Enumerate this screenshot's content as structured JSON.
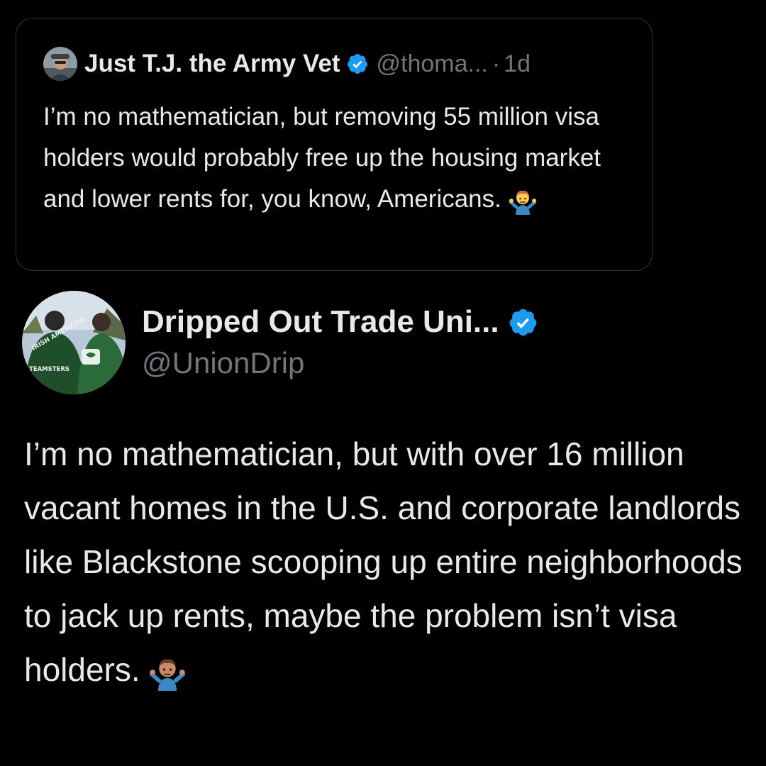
{
  "quoted_tweet": {
    "author_name": "Just T.J. the Army Vet",
    "handle": "@thoma...",
    "separator": "·",
    "time": "1d",
    "text": "I’m no mathematician, but removing 55 million visa holders would probably free up the housing market and lower rents for, you know, Americans.",
    "emoji": "man-shrugging",
    "verified": true
  },
  "tweet": {
    "author_name": "Dripped Out Trade Uni...",
    "handle": "@UnionDrip",
    "text": "I’m no mathematician, but with over 16 million vacant homes in the U.S. and corporate landlords like Blackstone scooping up entire neighborhoods to jack up rents, maybe the problem isn’t visa holders.",
    "emoji": "person-shrugging",
    "verified": true,
    "avatar_jacket_texts": [
      "IRISH AMERICAN",
      "TEAMSTERS"
    ]
  },
  "colors": {
    "background": "#000000",
    "text_primary": "#e7e9ea",
    "text_secondary": "#71767b",
    "verified_badge": "#1d9bf0",
    "card_border": "#2f3336"
  },
  "icons": [
    "verified-badge-icon",
    "man-shrugging-emoji-icon",
    "person-shrugging-emoji-icon"
  ]
}
